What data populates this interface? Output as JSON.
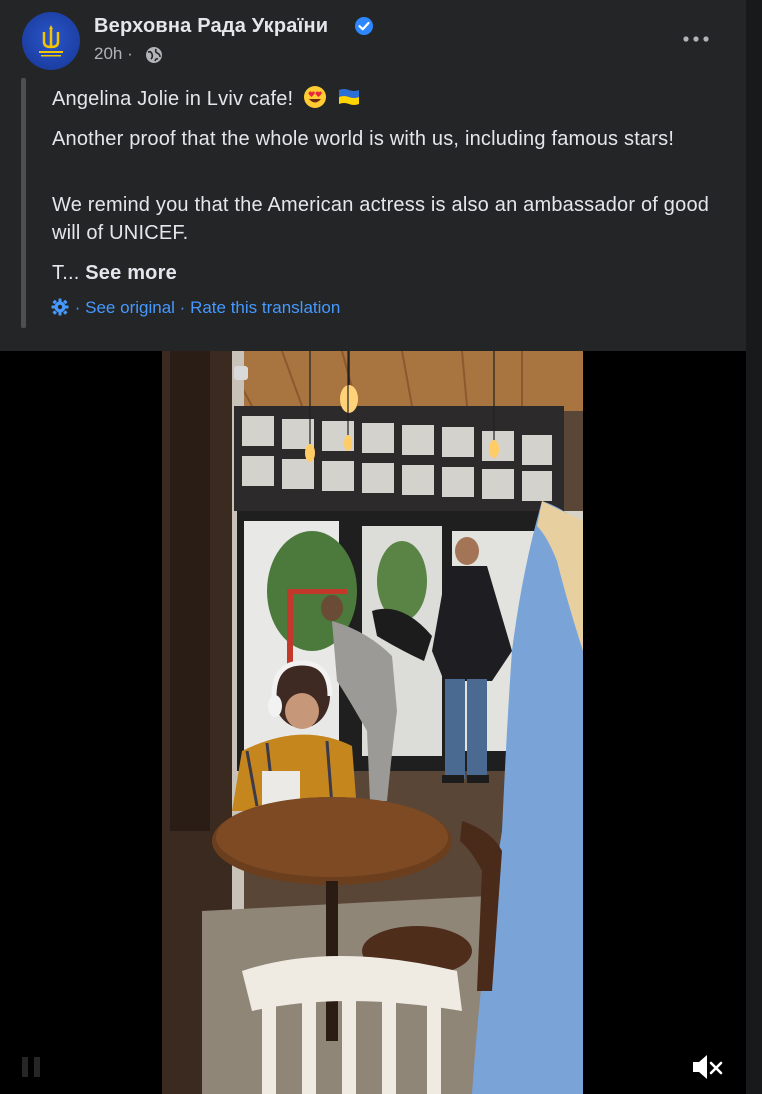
{
  "post": {
    "page_name": "Верховна Рада України",
    "time": "20h",
    "lines": {
      "line1": "Angelina Jolie in Lviv cafe!",
      "line2": "Another proof that the whole world is with us, including famous stars!",
      "line3": "We remind you that the American actress is also an ambassador of good will of UNICEF.",
      "truncated": "T...",
      "see_more": "See more"
    },
    "translation": {
      "see_original": "See original",
      "rate": "Rate this translation",
      "separator": "·"
    },
    "meta_separator": "·"
  },
  "icons": {
    "verified": "verified-badge-icon",
    "privacy": "globe-icon",
    "more": "more-options-icon",
    "settings": "gear-icon",
    "mute": "muted-speaker-icon"
  },
  "colors": {
    "background": "#242526",
    "text": "#e4e6eb",
    "secondary": "#b0b3b8",
    "link": "#4599ff",
    "verified": "#2d88ff"
  },
  "video": {
    "muted": true
  }
}
